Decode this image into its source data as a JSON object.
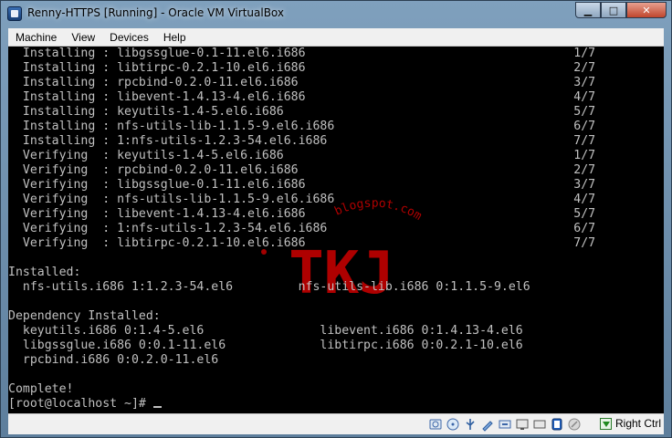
{
  "window": {
    "title": "Renny-HTTPS [Running] - Oracle VM VirtualBox"
  },
  "menu": [
    "Machine",
    "View",
    "Devices",
    "Help"
  ],
  "console_lines": [
    "  Installing : libgssglue-0.1-11.el6.i686                                     1/7",
    "  Installing : libtirpc-0.2.1-10.el6.i686                                     2/7",
    "  Installing : rpcbind-0.2.0-11.el6.i686                                      3/7",
    "  Installing : libevent-1.4.13-4.el6.i686                                     4/7",
    "  Installing : keyutils-1.4-5.el6.i686                                        5/7",
    "  Installing : nfs-utils-lib-1.1.5-9.el6.i686                                 6/7",
    "  Installing : 1:nfs-utils-1.2.3-54.el6.i686                                  7/7",
    "  Verifying  : keyutils-1.4-5.el6.i686                                        1/7",
    "  Verifying  : rpcbind-0.2.0-11.el6.i686                                      2/7",
    "  Verifying  : libgssglue-0.1-11.el6.i686                                     3/7",
    "  Verifying  : nfs-utils-lib-1.1.5-9.el6.i686                                 4/7",
    "  Verifying  : libevent-1.4.13-4.el6.i686                                     5/7",
    "  Verifying  : 1:nfs-utils-1.2.3-54.el6.i686                                  6/7",
    "  Verifying  : libtirpc-0.2.1-10.el6.i686                                     7/7",
    "",
    "Installed:",
    "  nfs-utils.i686 1:1.2.3-54.el6         nfs-utils-lib.i686 0:1.1.5-9.el6",
    "",
    "Dependency Installed:",
    "  keyutils.i686 0:1.4-5.el6                libevent.i686 0:1.4.13-4.el6",
    "  libgssglue.i686 0:0.1-11.el6             libtirpc.i686 0:0.2.1-10.el6",
    "  rpcbind.i686 0:0.2.0-11.el6",
    "",
    "Complete!",
    "[root@localhost ~]# "
  ],
  "watermark": {
    "text": "TKJ",
    "url_text": "blogspot.com",
    "color": "#d40000"
  },
  "statusbar": {
    "host_key": "Right Ctrl"
  },
  "icons": [
    "minimize-icon",
    "maximize-icon",
    "close-icon",
    "hdd-icon",
    "cd-icon",
    "usb-icon",
    "shared-folder-icon",
    "network-icon",
    "display-icon",
    "virtualization-icon",
    "mouse-integration-icon",
    "host-key-arrow-icon"
  ]
}
